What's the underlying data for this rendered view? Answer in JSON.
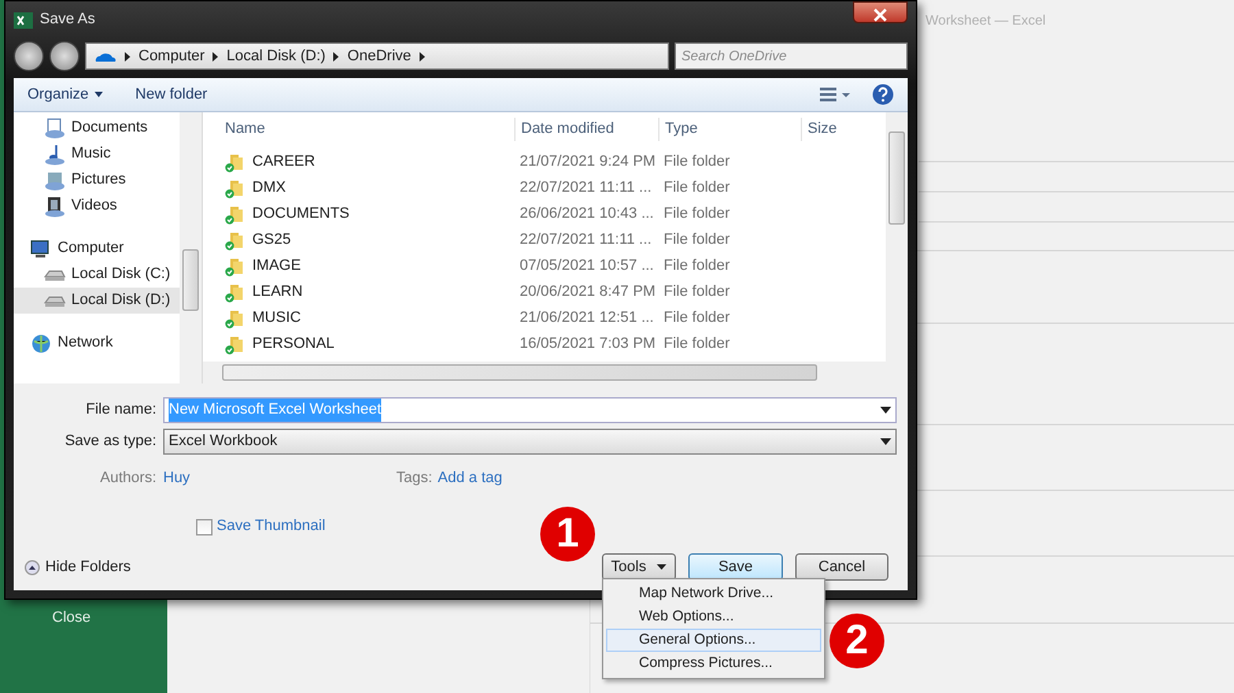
{
  "background_window": {
    "title": "Worksheet — Excel",
    "sidebar_items": [
      {
        "label": "Close"
      }
    ]
  },
  "dialog": {
    "title": "Save As",
    "breadcrumb": [
      "Computer",
      "Local Disk (D:)",
      "OneDrive"
    ],
    "search": {
      "placeholder": "Search OneDrive"
    },
    "toolbar": [
      {
        "label": "Organize",
        "dropdown": true
      },
      {
        "label": "New folder",
        "dropdown": false
      }
    ],
    "nav": [
      {
        "children": [
          {
            "label": "Documents",
            "kind": "documents",
            "selected": false
          },
          {
            "label": "Music",
            "kind": "music",
            "selected": false
          },
          {
            "label": "Pictures",
            "kind": "pictures",
            "selected": false
          },
          {
            "label": "Videos",
            "kind": "videos",
            "selected": false
          }
        ]
      },
      {
        "label": "Computer",
        "kind": "computer",
        "selected": false,
        "children": [
          {
            "label": "Local Disk (C:)",
            "kind": "drive",
            "selected": false
          },
          {
            "label": "Local Disk (D:)",
            "kind": "drive",
            "selected": true
          }
        ]
      },
      {
        "label": "Network",
        "kind": "network",
        "selected": false
      }
    ],
    "table": {
      "columns": [
        "Name",
        "Date modified",
        "Type",
        "Size"
      ],
      "rows": [
        {
          "name": "CAREER",
          "date": "21/07/2021 9:24 PM",
          "type": "File folder"
        },
        {
          "name": "DMX",
          "date": "22/07/2021 11:11 ...",
          "type": "File folder"
        },
        {
          "name": "DOCUMENTS",
          "date": "26/06/2021 10:43 ...",
          "type": "File folder"
        },
        {
          "name": "GS25",
          "date": "22/07/2021 11:11 ...",
          "type": "File folder"
        },
        {
          "name": "IMAGE",
          "date": "07/05/2021 10:57 ...",
          "type": "File folder"
        },
        {
          "name": "LEARN",
          "date": "20/06/2021 8:47 PM",
          "type": "File folder"
        },
        {
          "name": "MUSIC",
          "date": "21/06/2021 12:51 ...",
          "type": "File folder"
        },
        {
          "name": "PERSONAL",
          "date": "16/05/2021 7:03 PM",
          "type": "File folder"
        }
      ]
    },
    "file_name": {
      "label": "File name:",
      "value": "New Microsoft Excel Worksheet",
      "text_selected": true
    },
    "save_as_type": {
      "label": "Save as type:",
      "value": "Excel Workbook"
    },
    "authors": {
      "label": "Authors:",
      "value": "Huy"
    },
    "tags": {
      "label": "Tags:",
      "value": "Add a tag"
    },
    "save_thumbnail": {
      "label": "Save Thumbnail",
      "checked": false
    },
    "hide_folders": "Hide Folders",
    "buttons": [
      {
        "label": "Tools",
        "kind": "menu"
      },
      {
        "label": "Save",
        "kind": "default"
      },
      {
        "label": "Cancel",
        "kind": "plain"
      }
    ],
    "tools_menu": [
      {
        "label": "Map Network Drive...",
        "selected": false
      },
      {
        "label": "Web Options...",
        "selected": false
      },
      {
        "label": "General Options...",
        "selected": true
      },
      {
        "label": "Compress Pictures...",
        "selected": false
      }
    ]
  },
  "annotations": [
    "1",
    "2"
  ]
}
